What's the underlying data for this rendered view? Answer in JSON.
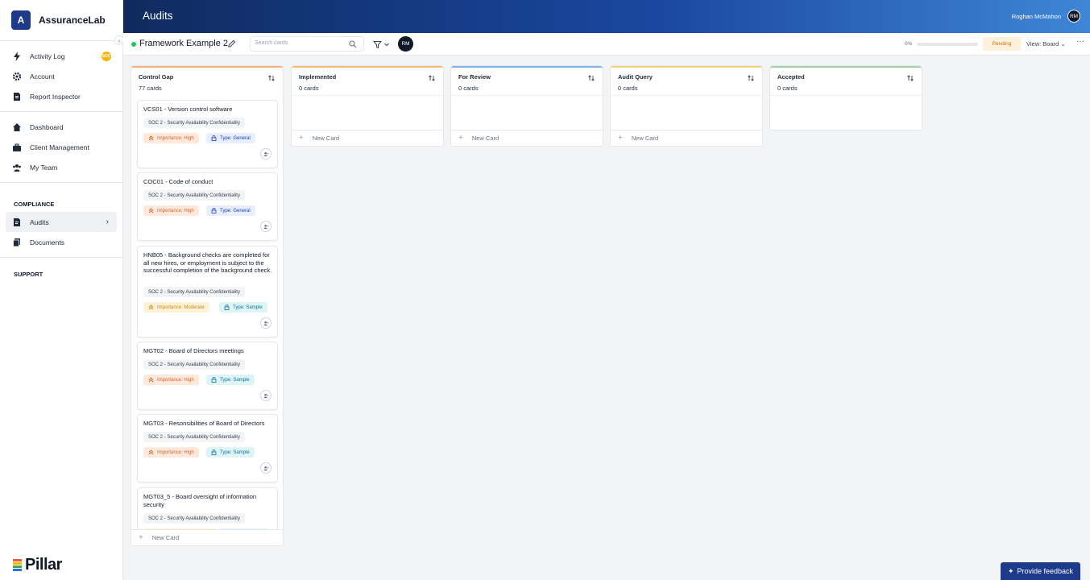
{
  "org": {
    "initial": "A",
    "name": "AssuranceLab"
  },
  "sidebar": {
    "group1": [
      {
        "label": "Activity Log",
        "icon": "bolt-icon",
        "badge": "SOC"
      },
      {
        "label": "Account",
        "icon": "gear-icon"
      },
      {
        "label": "Report Inspector",
        "icon": "report-icon"
      }
    ],
    "group2": [
      {
        "label": "Dashboard",
        "icon": "home-icon"
      },
      {
        "label": "Client Management",
        "icon": "briefcase-icon"
      },
      {
        "label": "My Team",
        "icon": "team-icon"
      }
    ],
    "compliance_title": "COMPLIANCE",
    "compliance": [
      {
        "label": "Audits",
        "icon": "audit-icon",
        "active": true
      },
      {
        "label": "Documents",
        "icon": "documents-icon"
      }
    ],
    "support_title": "SUPPORT",
    "brand": "Pillar",
    "brand_colors": [
      "#e85d3a",
      "#f5b800",
      "#3ba55c",
      "#2f6fd6"
    ]
  },
  "header": {
    "title": "Audits",
    "user_name": "Roghan McMahon",
    "user_initials": "RM"
  },
  "toolbar": {
    "framework_name": "Framework Example 2",
    "search_placeholder": "Search cards",
    "assignee_initials": "RM",
    "progress_label": "0%",
    "progress_fraction": 0,
    "status": "Pending",
    "view_label": "View: Board",
    "more_label": "···"
  },
  "columns": [
    {
      "title": "Control Gap",
      "count": "77 cards",
      "accent": "#f0b27a",
      "new_card": "New Card"
    },
    {
      "title": "Implemented",
      "count": "0 cards",
      "accent": "#f0c070",
      "new_card": "New Card"
    },
    {
      "title": "For Review",
      "count": "0 cards",
      "accent": "#7fb3e8",
      "new_card": "New Card"
    },
    {
      "title": "Audit Query",
      "count": "0 cards",
      "accent": "#f3d27a",
      "new_card": "New Card"
    },
    {
      "title": "Accepted",
      "count": "0 cards",
      "accent": "#9ad4a6",
      "new_card": null
    }
  ],
  "cards": [
    {
      "title": "VCS01 - Version control software",
      "framework": "SOC 2 - Security Availability Confidentiality",
      "importance": "Importance: High",
      "importance_level": "high",
      "type": "Type: General",
      "type_kind": "general"
    },
    {
      "title": "COC01 - Code of conduct",
      "framework": "SOC 2 - Security Availability Confidentiality",
      "importance": "Importance: High",
      "importance_level": "high",
      "type": "Type: General",
      "type_kind": "general"
    },
    {
      "title": "HNB05 - Background checks are completed for all new hires, or employment is subject to the successful completion of the background check.",
      "framework": "SOC 2 - Security Availability Confidentiality",
      "importance": "Importance: Moderate",
      "importance_level": "moderate",
      "type": "Type: Sample",
      "type_kind": "sample"
    },
    {
      "title": "MGT02 - Board of Directors meetings",
      "framework": "SOC 2 - Security Availability Confidentiality",
      "importance": "Importance: High",
      "importance_level": "high",
      "type": "Type: Sample",
      "type_kind": "sample"
    },
    {
      "title": "MGT03 - Resonsibilities of Board of Directors",
      "framework": "SOC 2 - Security Availability Confidentiality",
      "importance": "Importance: High",
      "importance_level": "high",
      "type": "Type: Sample",
      "type_kind": "sample"
    },
    {
      "title": "MGT03_5 - Board oversight of information security",
      "framework": "SOC 2 - Security Availability Confidentiality",
      "importance": "",
      "importance_level": "moderate",
      "type": "",
      "type_kind": "sample"
    }
  ],
  "feedback_label": "Provide feedback"
}
